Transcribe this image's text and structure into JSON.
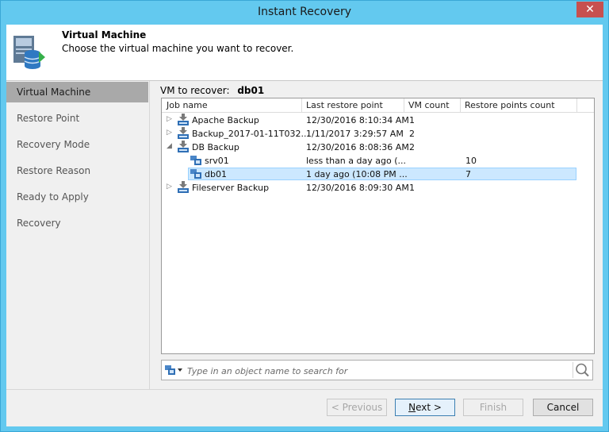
{
  "window": {
    "title": "Instant Recovery",
    "close_glyph": "✕"
  },
  "header": {
    "title": "Virtual Machine",
    "subtitle": "Choose the virtual machine you want to recover."
  },
  "steps": [
    "Virtual Machine",
    "Restore Point",
    "Recovery Mode",
    "Restore Reason",
    "Ready to Apply",
    "Recovery"
  ],
  "active_step": "Virtual Machine",
  "vm_to_recover": {
    "label": "VM to recover:",
    "value": "db01"
  },
  "grid": {
    "columns": [
      "Job name",
      "Last restore point",
      "VM count",
      "Restore points count"
    ],
    "rows": [
      {
        "name": "Apache Backup",
        "last": "12/30/2016 8:10:34 AM",
        "vm_count": "1",
        "rp_count": "",
        "expander": "▷",
        "icon": "backup-job-icon",
        "level": 0
      },
      {
        "name": "Backup_2017-01-11T032...",
        "last": "1/11/2017 3:29:57 AM",
        "vm_count": "2",
        "rp_count": "",
        "expander": "▷",
        "icon": "backup-job-icon",
        "level": 0
      },
      {
        "name": "DB Backup",
        "last": "12/30/2016 8:08:36 AM",
        "vm_count": "2",
        "rp_count": "",
        "expander": "◢",
        "icon": "backup-job-icon",
        "level": 0
      },
      {
        "name": "srv01",
        "last": "less than a day ago (...",
        "vm_count": "",
        "rp_count": "10",
        "expander": "",
        "icon": "vm-icon",
        "level": 1
      },
      {
        "name": "db01",
        "last": "1 day ago (10:08 PM ...",
        "vm_count": "",
        "rp_count": "7",
        "expander": "",
        "icon": "vm-icon",
        "level": 1,
        "selected": true
      },
      {
        "name": "Fileserver Backup",
        "last": "12/30/2016 8:09:30 AM",
        "vm_count": "1",
        "rp_count": "",
        "expander": "▷",
        "icon": "backup-job-icon",
        "level": 0
      }
    ]
  },
  "search": {
    "placeholder": "Type in an object name to search for",
    "value": ""
  },
  "buttons": {
    "previous": "< Previous",
    "next_mnemonic": "N",
    "next_rest": "ext >",
    "finish": "Finish",
    "cancel": "Cancel"
  },
  "colors": {
    "titlebar": "#63c9ef",
    "active_step": "#a9a9a9",
    "selection": "#cce8ff",
    "close": "#c7504f"
  }
}
